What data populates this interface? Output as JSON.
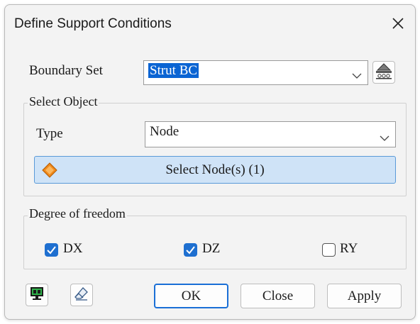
{
  "window": {
    "title": "Define Support Conditions"
  },
  "boundary": {
    "label": "Boundary Set",
    "value": "Strut BC"
  },
  "select_object": {
    "group_label": "Select Object",
    "type_label": "Type",
    "type_value": "Node",
    "select_button_label": "Select Node(s) (1)"
  },
  "dof": {
    "group_label": "Degree of freedom",
    "items": [
      {
        "label": "DX",
        "checked": true
      },
      {
        "label": "DZ",
        "checked": true
      },
      {
        "label": "RY",
        "checked": false
      }
    ]
  },
  "buttons": {
    "ok": "OK",
    "close": "Close",
    "apply": "Apply"
  },
  "icons": {
    "manager": "support-manager-icon",
    "select_node": "node-diamond-icon",
    "display": "display-icon",
    "eraser": "eraser-icon"
  },
  "colors": {
    "accent": "#1e6fd0",
    "select_bg": "#cfe3f7",
    "node_icon": "#f08a1c"
  }
}
